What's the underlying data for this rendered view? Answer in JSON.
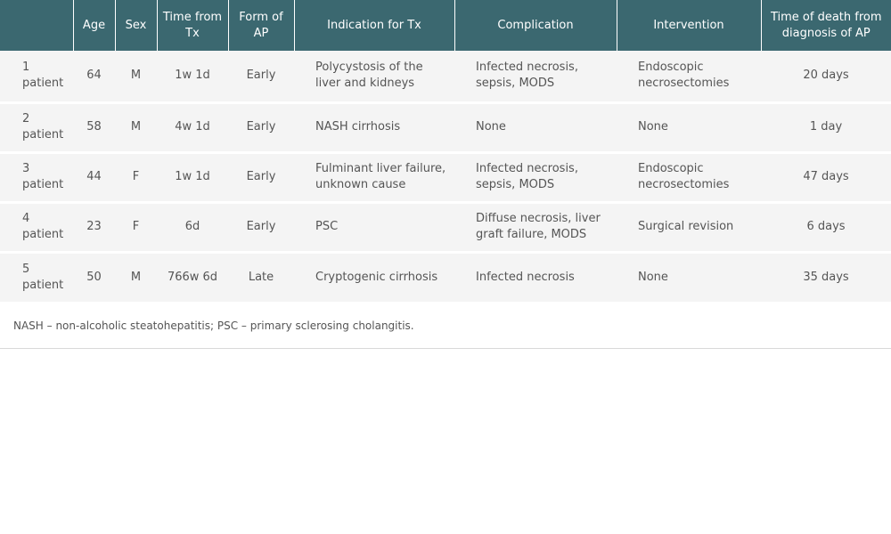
{
  "table": {
    "headers": [
      "",
      "Age",
      "Sex",
      "Time from Tx",
      "Form of AP",
      "Indication for Tx",
      "Complication",
      "Intervention",
      "Time of death from diagnosis of AP"
    ],
    "rows": [
      [
        "1 patient",
        "64",
        "M",
        "1w 1d",
        "Early",
        "Polycystosis of the liver and kidneys",
        "Infected necrosis, sepsis, MODS",
        "Endoscopic necrosectomies",
        "20 days"
      ],
      [
        "2 patient",
        "58",
        "M",
        "4w 1d",
        "Early",
        "NASH cirrhosis",
        "None",
        "None",
        "1 day"
      ],
      [
        "3 patient",
        "44",
        "F",
        "1w 1d",
        "Early",
        "Fulminant liver failure, unknown cause",
        "Infected necrosis, sepsis, MODS",
        "Endoscopic necrosectomies",
        "47 days"
      ],
      [
        "4 patient",
        "23",
        "F",
        "6d",
        "Early",
        "PSC",
        "Diffuse necrosis, liver graft failure, MODS",
        "Surgical revision",
        "6 days"
      ],
      [
        "5 patient",
        "50",
        "M",
        "766w 6d",
        "Late",
        "Cryptogenic cirrhosis",
        "Infected necrosis",
        "None",
        "35 days"
      ]
    ]
  },
  "footnote": "NASH – non-alcoholic steatohepatitis; PSC – primary sclerosing cholangitis.",
  "colors": {
    "header_bg": "#3b6870",
    "row_bg": "#f4f4f4"
  }
}
